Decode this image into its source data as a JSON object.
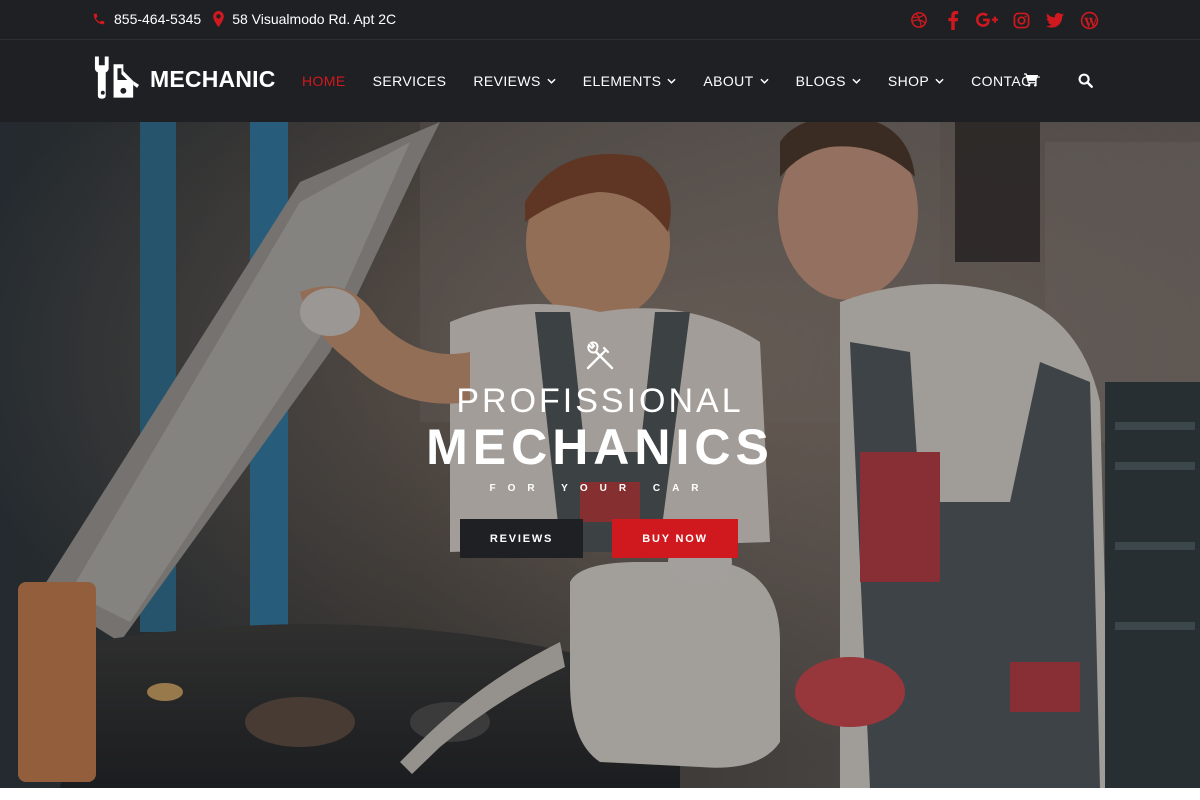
{
  "topbar": {
    "phone": "855-464-5345",
    "address": "58 Visualmodo Rd. Apt 2C",
    "social": [
      "dribbble-icon",
      "facebook-icon",
      "google-plus-icon",
      "instagram-icon",
      "twitter-icon",
      "wordpress-icon"
    ]
  },
  "brand": {
    "name": "MECHANIC"
  },
  "nav": {
    "items": [
      {
        "label": "HOME",
        "active": true
      },
      {
        "label": "SERVICES"
      },
      {
        "label": "REVIEWS",
        "dropdown": true
      },
      {
        "label": "ELEMENTS",
        "dropdown": true
      },
      {
        "label": "ABOUT",
        "dropdown": true
      },
      {
        "label": "BLOGS",
        "dropdown": true
      },
      {
        "label": "SHOP",
        "dropdown": true
      },
      {
        "label": "CONTACT"
      }
    ]
  },
  "hero": {
    "subtitle": "PROFISSIONAL",
    "title": "MECHANICS",
    "tagline": "FOR YOUR CAR",
    "btn_reviews": "REVIEWS",
    "btn_buy": "BUY NOW"
  },
  "colors": {
    "accent": "#d0191e",
    "dark": "#1f2024"
  }
}
